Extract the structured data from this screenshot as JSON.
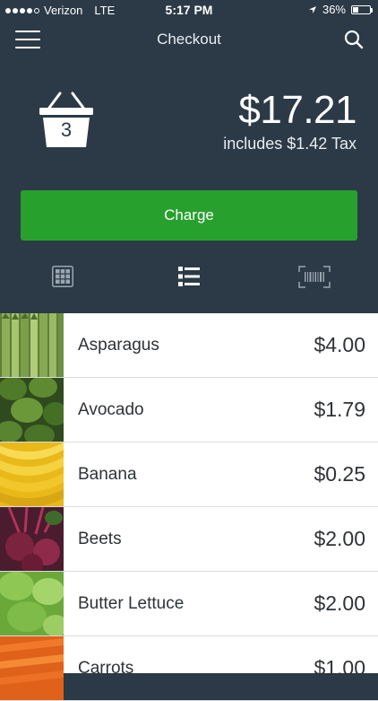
{
  "status": {
    "carrier": "Verizon",
    "network": "LTE",
    "time": "5:17 PM",
    "battery": "36%",
    "battery_level": 0.36
  },
  "nav": {
    "title": "Checkout"
  },
  "cart": {
    "item_count": "3",
    "total": "$17.21",
    "tax_line": "includes $1.42 Tax"
  },
  "actions": {
    "charge_label": "Charge"
  },
  "view_modes": [
    {
      "name": "grid-view",
      "icon": "grid-icon",
      "active": false
    },
    {
      "name": "list-view",
      "icon": "list-icon",
      "active": true
    },
    {
      "name": "barcode-scan",
      "icon": "barcode-icon",
      "active": false
    }
  ],
  "products": [
    {
      "name": "Asparagus",
      "price": "$4.00"
    },
    {
      "name": "Avocado",
      "price": "$1.79"
    },
    {
      "name": "Banana",
      "price": "$0.25"
    },
    {
      "name": "Beets",
      "price": "$2.00"
    },
    {
      "name": "Butter Lettuce",
      "price": "$2.00"
    },
    {
      "name": "Carrots",
      "price": "$1.00"
    }
  ],
  "colors": {
    "header_bg": "#2c3a47",
    "charge_green": "#28a02e",
    "text_dark": "#2f3336"
  }
}
